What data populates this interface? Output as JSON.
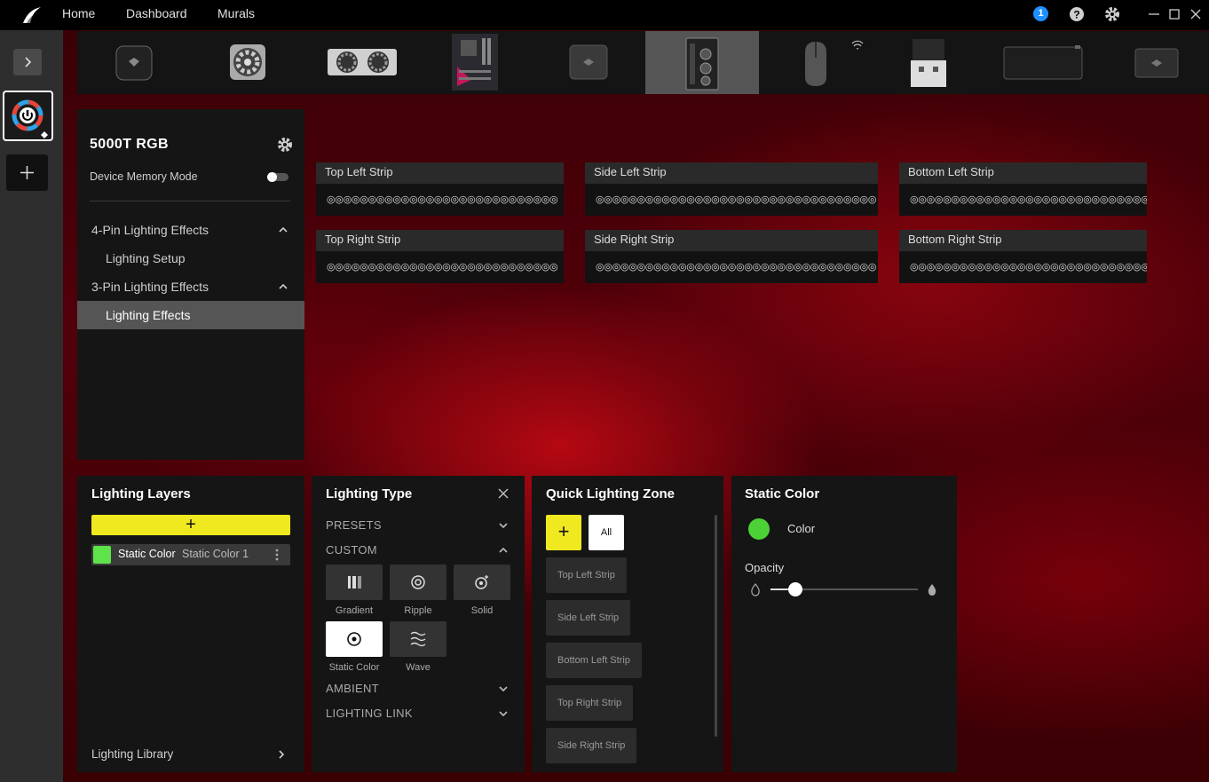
{
  "topbar": {
    "nav": [
      "Home",
      "Dashboard",
      "Murals"
    ],
    "notification_count": "1"
  },
  "device": {
    "name": "5000T RGB",
    "memory_mode_label": "Device Memory Mode",
    "memory_mode_on": false
  },
  "sidebar": {
    "items": [
      {
        "label": "4-Pin Lighting Effects"
      },
      {
        "label": "Lighting Setup"
      },
      {
        "label": "3-Pin Lighting Effects"
      },
      {
        "label": "Lighting Effects"
      }
    ]
  },
  "strips": [
    {
      "name": "Top Left Strip",
      "leds": "◎◎◎◎◎◎◎◎◎◎◎◎◎◎◎◎◎◎◎◎◎◎◎◎◎◎◎◎"
    },
    {
      "name": "Side Left Strip",
      "leds": "◎◎◎◎◎◎◎◎◎◎◎◎◎◎◎◎◎◎◎◎◎◎◎◎◎◎◎◎◎◎◎◎◎◎"
    },
    {
      "name": "Bottom Left Strip",
      "leds": "◎◎◎◎◎◎◎◎◎◎◎◎◎◎◎◎◎◎◎◎◎◎◎◎◎◎◎◎◎◎◎◎◎◎"
    },
    {
      "name": "Top Right Strip",
      "leds": "◎◎◎◎◎◎◎◎◎◎◎◎◎◎◎◎◎◎◎◎◎◎◎◎◎◎◎◎"
    },
    {
      "name": "Side Right Strip",
      "leds": "◎◎◎◎◎◎◎◎◎◎◎◎◎◎◎◎◎◎◎◎◎◎◎◎◎◎◎◎◎◎◎◎◎◎"
    },
    {
      "name": "Bottom Right Strip",
      "leds": "◎◎◎◎◎◎◎◎◎◎◎◎◎◎◎◎◎◎◎◎◎◎◎◎◎◎◎◎◎◎◎◎◎◎"
    }
  ],
  "layers": {
    "title": "Lighting Layers",
    "add_symbol": "+",
    "items": [
      {
        "type": "Static Color",
        "name": "Static Color 1",
        "color": "#5ee34a"
      }
    ],
    "library_label": "Lighting Library"
  },
  "lighting_type": {
    "title": "Lighting Type",
    "sections": [
      "PRESETS",
      "CUSTOM",
      "AMBIENT",
      "LIGHTING LINK"
    ],
    "custom_effects": [
      "Gradient",
      "Ripple",
      "Solid",
      "Static Color",
      "Wave"
    ],
    "selected": "Static Color"
  },
  "quick_zone": {
    "title": "Quick Lighting Zone",
    "add_symbol": "+",
    "all_label": "All",
    "zones": [
      "Top Left Strip",
      "Side Left Strip",
      "Bottom Left Strip",
      "Top Right Strip",
      "Side Right Strip"
    ]
  },
  "static_color": {
    "title": "Static Color",
    "color_label": "Color",
    "color": "#4cd137",
    "opacity_label": "Opacity",
    "opacity_fraction": 0.17
  },
  "colors": {
    "accent_yellow": "#f0e91f",
    "layer_green": "#5ee34a"
  }
}
